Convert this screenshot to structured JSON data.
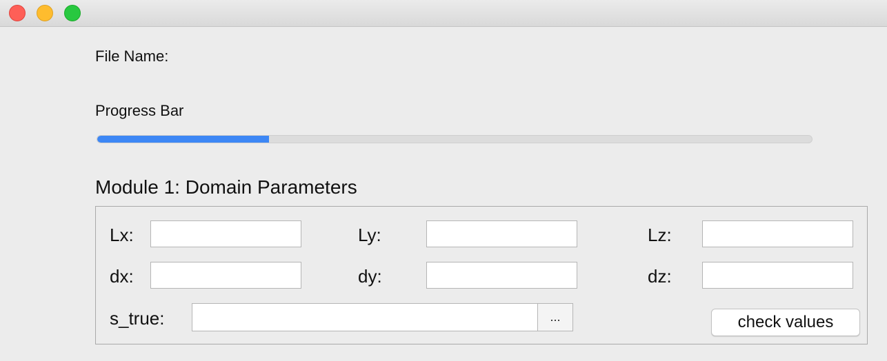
{
  "window": {
    "controls": [
      "close-button",
      "minimize-button",
      "zoom-button"
    ],
    "colors": {
      "close": "#fe5f57",
      "minimize": "#febc2e",
      "zoom": "#28c840"
    }
  },
  "file": {
    "label": "File Name:"
  },
  "progress": {
    "label": "Progress Bar",
    "value_percent": 24,
    "color": "#3d87f5"
  },
  "module1": {
    "title": "Module 1: Domain Parameters",
    "fields": {
      "lx": {
        "label": "Lx:",
        "value": ""
      },
      "ly": {
        "label": "Ly:",
        "value": ""
      },
      "lz": {
        "label": "Lz:",
        "value": ""
      },
      "dx": {
        "label": "dx:",
        "value": ""
      },
      "dy": {
        "label": "dy:",
        "value": ""
      },
      "dz": {
        "label": "dz:",
        "value": ""
      },
      "s_true": {
        "label": "s_true:",
        "value": ""
      }
    },
    "browse_label": "...",
    "check_label": "check values"
  }
}
